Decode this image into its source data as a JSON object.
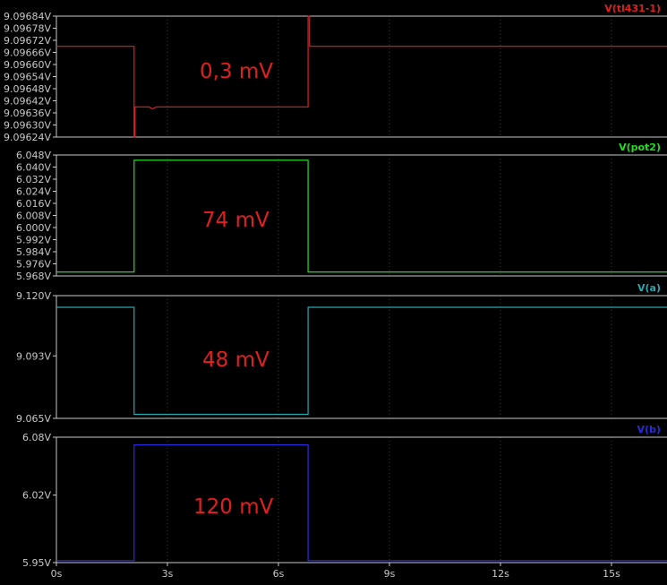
{
  "chart_data": [
    {
      "type": "line",
      "trace_name": "V(tl431-1)",
      "color": "#e02020",
      "annotation": "0,3 mV",
      "annotation_color": "#e02020",
      "ylim": [
        9.09624,
        9.09684
      ],
      "yticks": [
        "9.09684V",
        "9.09678V",
        "9.09672V",
        "9.09666V",
        "9.09660V",
        "9.09654V",
        "9.09648V",
        "9.09642V",
        "9.09636V",
        "9.09630V",
        "9.09624V"
      ],
      "ytick_values": [
        9.09684,
        9.09678,
        9.09672,
        9.09666,
        9.0966,
        9.09654,
        9.09648,
        9.09642,
        9.09636,
        9.0963,
        9.09624
      ],
      "points": [
        [
          0,
          9.09669
        ],
        [
          2.1,
          9.09669
        ],
        [
          2.1,
          9.09624
        ],
        [
          2.12,
          9.09624
        ],
        [
          2.12,
          9.09639
        ],
        [
          2.5,
          9.09639
        ],
        [
          2.6,
          9.09638
        ],
        [
          2.7,
          9.09639
        ],
        [
          6.8,
          9.09639
        ],
        [
          6.8,
          9.09684
        ],
        [
          6.84,
          9.09684
        ],
        [
          6.84,
          9.09669
        ],
        [
          16.5,
          9.09669
        ]
      ]
    },
    {
      "type": "line",
      "trace_name": "V(pot2)",
      "color": "#22dd22",
      "annotation": "74 mV",
      "annotation_color": "#e02020",
      "ylim": [
        5.968,
        6.048
      ],
      "yticks": [
        "6.048V",
        "6.040V",
        "6.032V",
        "6.024V",
        "6.016V",
        "6.008V",
        "6.000V",
        "5.992V",
        "5.984V",
        "5.976V",
        "5.968V"
      ],
      "ytick_values": [
        6.048,
        6.04,
        6.032,
        6.024,
        6.016,
        6.008,
        6.0,
        5.992,
        5.984,
        5.976,
        5.968
      ],
      "points": [
        [
          0,
          5.9706
        ],
        [
          2.1,
          5.9706
        ],
        [
          2.1,
          6.0445
        ],
        [
          6.8,
          6.0445
        ],
        [
          6.8,
          5.9706
        ],
        [
          16.5,
          5.9706
        ]
      ]
    },
    {
      "type": "line",
      "trace_name": "V(a)",
      "color": "#2aa7b0",
      "annotation": "48 mV",
      "annotation_color": "#e02020",
      "ylim": [
        9.065,
        9.12
      ],
      "yticks": [
        "9.120V",
        "9.093V",
        "9.065V"
      ],
      "ytick_values": [
        9.12,
        9.093,
        9.065
      ],
      "points": [
        [
          0,
          9.1148
        ],
        [
          2.1,
          9.1148
        ],
        [
          2.1,
          9.0668
        ],
        [
          6.8,
          9.0668
        ],
        [
          6.8,
          9.1148
        ],
        [
          16.5,
          9.1148
        ]
      ]
    },
    {
      "type": "line",
      "trace_name": "V(b)",
      "color": "#2a2ae0",
      "annotation": "120 mV",
      "annotation_color": "#e02020",
      "ylim": [
        5.95,
        6.08
      ],
      "yticks": [
        "6.08V",
        "6.02V",
        "5.95V"
      ],
      "ytick_values": [
        6.08,
        6.02,
        5.95
      ],
      "points": [
        [
          0,
          5.952
        ],
        [
          2.1,
          5.952
        ],
        [
          2.1,
          6.072
        ],
        [
          6.8,
          6.072
        ],
        [
          6.8,
          5.952
        ],
        [
          16.5,
          5.952
        ]
      ]
    }
  ],
  "x_axis": {
    "xlim": [
      0,
      16.5
    ],
    "ticks": [
      "0s",
      "3s",
      "6s",
      "9s",
      "12s",
      "15s"
    ],
    "tick_values": [
      0,
      3,
      6,
      9,
      12,
      15
    ]
  },
  "colors": {
    "background": "#000000",
    "axis_text": "#c8c8c8",
    "axis_line": "#c8c8c8",
    "grid": "#3a3a3a"
  }
}
